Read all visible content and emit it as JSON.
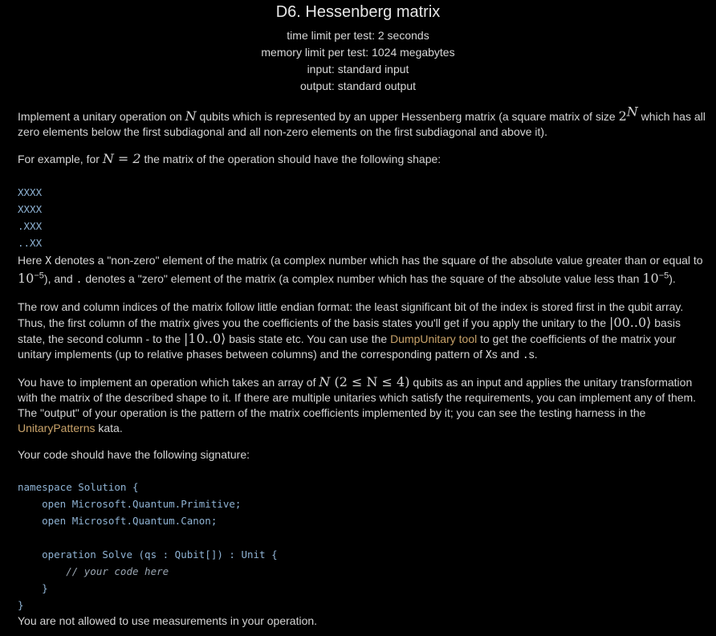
{
  "problem": {
    "title": "D6. Hessenberg matrix",
    "time_limit": "time limit per test: 2 seconds",
    "memory_limit": "memory limit per test: 1024 megabytes",
    "input": "input: standard input",
    "output": "output: standard output"
  },
  "para1": {
    "a": "Implement a unitary operation on ",
    "N": "N",
    "b": " qubits which is represented by an upper Hessenberg matrix (a square matrix of size ",
    "two": "2",
    "supN": "N",
    "c": " which has all zero elements below the first subdiagonal and all non-zero elements on the first subdiagonal and above it)."
  },
  "para2": {
    "a": "For example, for ",
    "math": "N = 2",
    "b": " the matrix of the operation should have the following shape:"
  },
  "matrix_rows": [
    "XXXX",
    "XXXX",
    ".XXX",
    "..XX"
  ],
  "para3": {
    "a": "Here ",
    "x": "X",
    "b": " denotes a \"non-zero\" element of the matrix (a complex number which has the square of the absolute value greater than or equal to ",
    "ten1": "10",
    "exp1": "−5",
    "c": "), and ",
    "dot": ".",
    "d": " denotes a \"zero\" element of the matrix (a complex number which has the square of the absolute value less than ",
    "ten2": "10",
    "exp2": "−5",
    "e": ")."
  },
  "para4": {
    "a": "The row and column indices of the matrix follow little endian format: the least significant bit of the index is stored first in the qubit array. Thus, the first column of the matrix gives you the coefficients of the basis states you'll get if you apply the unitary to the ",
    "ket1": "|00..0⟩",
    "b": " basis state, the second column - to the ",
    "ket2": "|10..0⟩",
    "c": " basis state etc. You can use the ",
    "link": "DumpUnitary tool",
    "d": " to get the coefficients of the matrix your unitary implements (up to relative phases between columns) and the corresponding pattern of ",
    "xs": "X",
    "e": "s and ",
    "dots": ".",
    "f": "s."
  },
  "para5": {
    "a": "You have to implement an operation which takes an array of ",
    "N": "N",
    "range": " (2 ≤ N ≤ 4)",
    "b": " qubits as an input and applies the unitary transformation with the matrix of the described shape to it. If there are multiple unitaries which satisfy the requirements, you can implement any of them. The \"output\" of your operation is the pattern of the matrix coefficients implemented by it; you can see the testing harness in the ",
    "link": "UnitaryPatterns",
    "c": " kata."
  },
  "para6": "Your code should have the following signature:",
  "code_lines": [
    "namespace Solution {",
    "    open Microsoft.Quantum.Primitive;",
    "    open Microsoft.Quantum.Canon;",
    "",
    "    operation Solve (qs : Qubit[]) : Unit {",
    "        // your code here",
    "    }",
    "}"
  ],
  "para7": "You are not allowed to use measurements in your operation."
}
